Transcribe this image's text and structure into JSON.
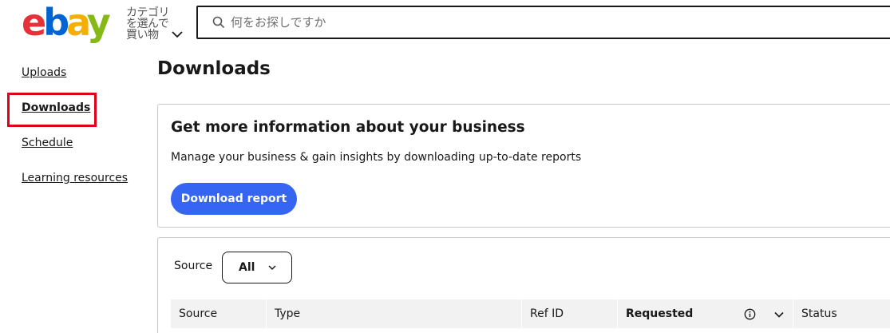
{
  "header": {
    "logo_text": "ebay",
    "logo_colors": [
      "#e53238",
      "#0064d2",
      "#f5af02",
      "#86b817"
    ],
    "category_label": "カテゴリを選んで買い物",
    "search_placeholder": "何をお探しですか"
  },
  "sidebar": {
    "items": [
      {
        "label": "Uploads",
        "active": false
      },
      {
        "label": "Downloads",
        "active": true
      },
      {
        "label": "Schedule",
        "active": false
      },
      {
        "label": "Learning resources",
        "active": false
      }
    ],
    "highlight_color": "#e0001b"
  },
  "main": {
    "title": "Downloads",
    "info_card": {
      "heading": "Get more information about your business",
      "text": "Manage your business & gain insights by downloading up-to-date reports",
      "button_label": "Download report",
      "button_color": "#3665f3"
    },
    "table": {
      "filter_label": "Source",
      "filter_value": "All",
      "columns": [
        "Source",
        "Type",
        "Ref ID",
        "Requested",
        "Status"
      ]
    }
  }
}
